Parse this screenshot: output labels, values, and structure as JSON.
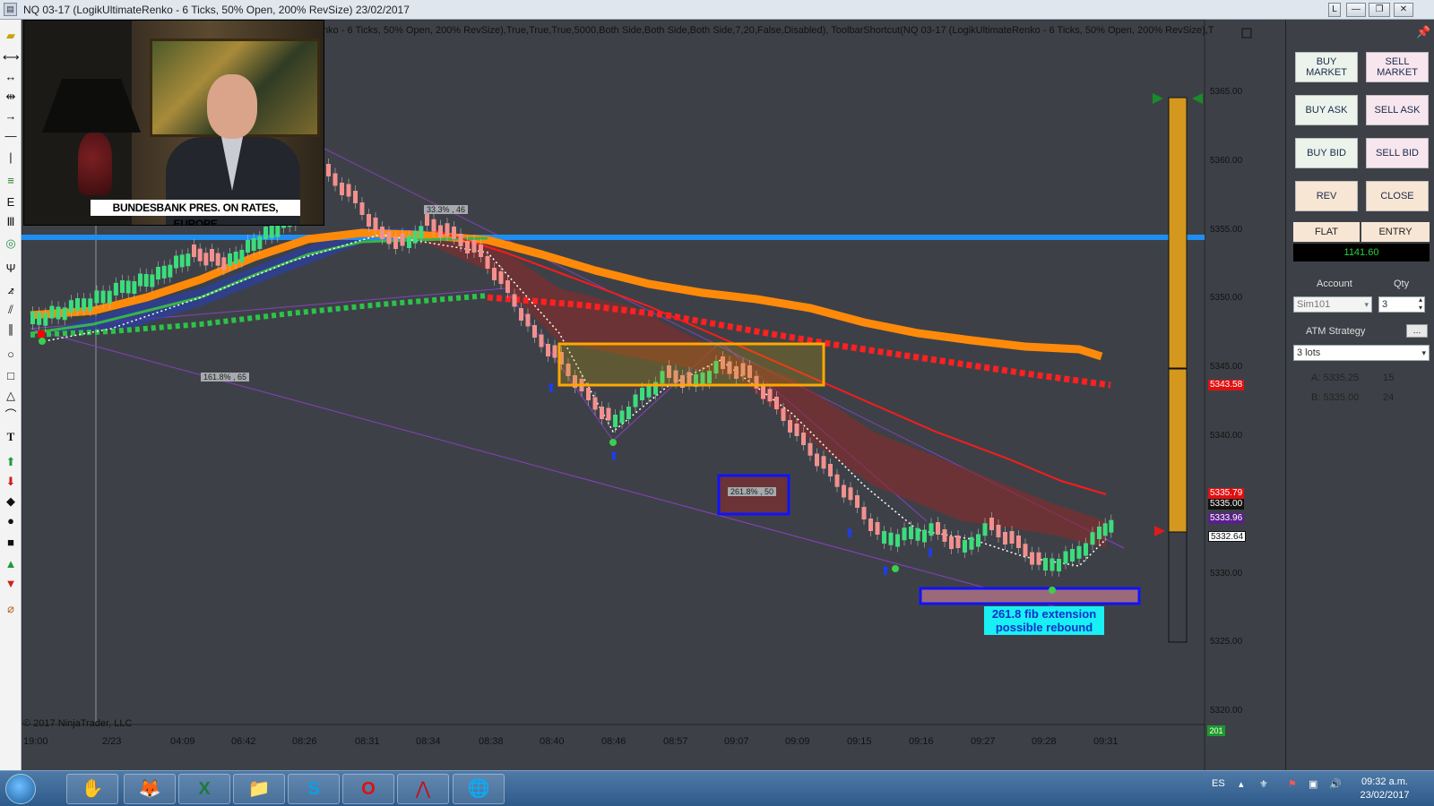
{
  "window": {
    "title": "NQ 03-17 (LogikUltimateRenko - 6 Ticks, 50% Open, 200% RevSize)  23/02/2017",
    "buttons": [
      "L",
      "—",
      "❐",
      "✕"
    ]
  },
  "chart": {
    "params": "nko - 6 Ticks, 50% Open, 200% RevSize),True,True,True,5000,Both Side,Both Side,Both Side,7,20,False,Disabled), ToolbarShortcut(NQ 03-17 (LogikUltimateRenko - 6 Ticks, 50% Open, 200% RevSize),T",
    "copyright": "© 2017 NinjaTrader, LLC",
    "price_labels": [
      "5365.00",
      "5360.00",
      "5355.00",
      "5350.00",
      "5345.00",
      "5340.00",
      "5335.00",
      "5330.00",
      "5325.00",
      "5320.00"
    ],
    "price_tags": [
      {
        "text": "5343.58",
        "color": "#e01010"
      },
      {
        "text": "5335.79",
        "color": "#e01010"
      },
      {
        "text": "5335.00",
        "color": "#111111"
      },
      {
        "text": "5333.96",
        "color": "#5b1f8a"
      },
      {
        "text": "5332.64",
        "color": "#ffffff"
      }
    ],
    "time_labels": [
      "19:00",
      "2/23",
      "04:09",
      "06:42",
      "08:26",
      "08:31",
      "08:34",
      "08:38",
      "08:40",
      "08:46",
      "08:57",
      "09:07",
      "09:09",
      "09:15",
      "09:16",
      "09:27",
      "09:28",
      "09:31"
    ],
    "annotations": {
      "fib_161": "161.8% , 65",
      "fib_333": "33.3% , 46",
      "fib_261": "261.8% , 50",
      "note": "261.8 fib extension possible rebound",
      "note_line1": "261.8 fib extension",
      "note_line2": "possible rebound"
    },
    "bar_count_badge": "201"
  },
  "video": {
    "caption": "BUNDESBANK PRES. ON RATES, EUROPE"
  },
  "panel": {
    "buy_market": "BUY MARKET",
    "sell_market": "SELL MARKET",
    "buy_ask": "BUY ASK",
    "sell_ask": "SELL ASK",
    "buy_bid": "BUY BID",
    "sell_bid": "SELL BID",
    "rev": "REV",
    "close": "CLOSE",
    "flat": "FLAT",
    "entry": "ENTRY",
    "pnl": "1141.60",
    "account_label": "Account",
    "qty_label": "Qty",
    "account_value": "Sim101",
    "qty_value": "3",
    "atm_label": "ATM Strategy",
    "atm_value": "3 lots",
    "ask": "A: 5335.25",
    "ask_size": "15",
    "bid": "B: 5335.00",
    "bid_size": "24",
    "pin": "📌"
  },
  "taskbar": {
    "lang": "ES",
    "time": "09:32 a.m.",
    "date": "23/02/2017"
  }
}
